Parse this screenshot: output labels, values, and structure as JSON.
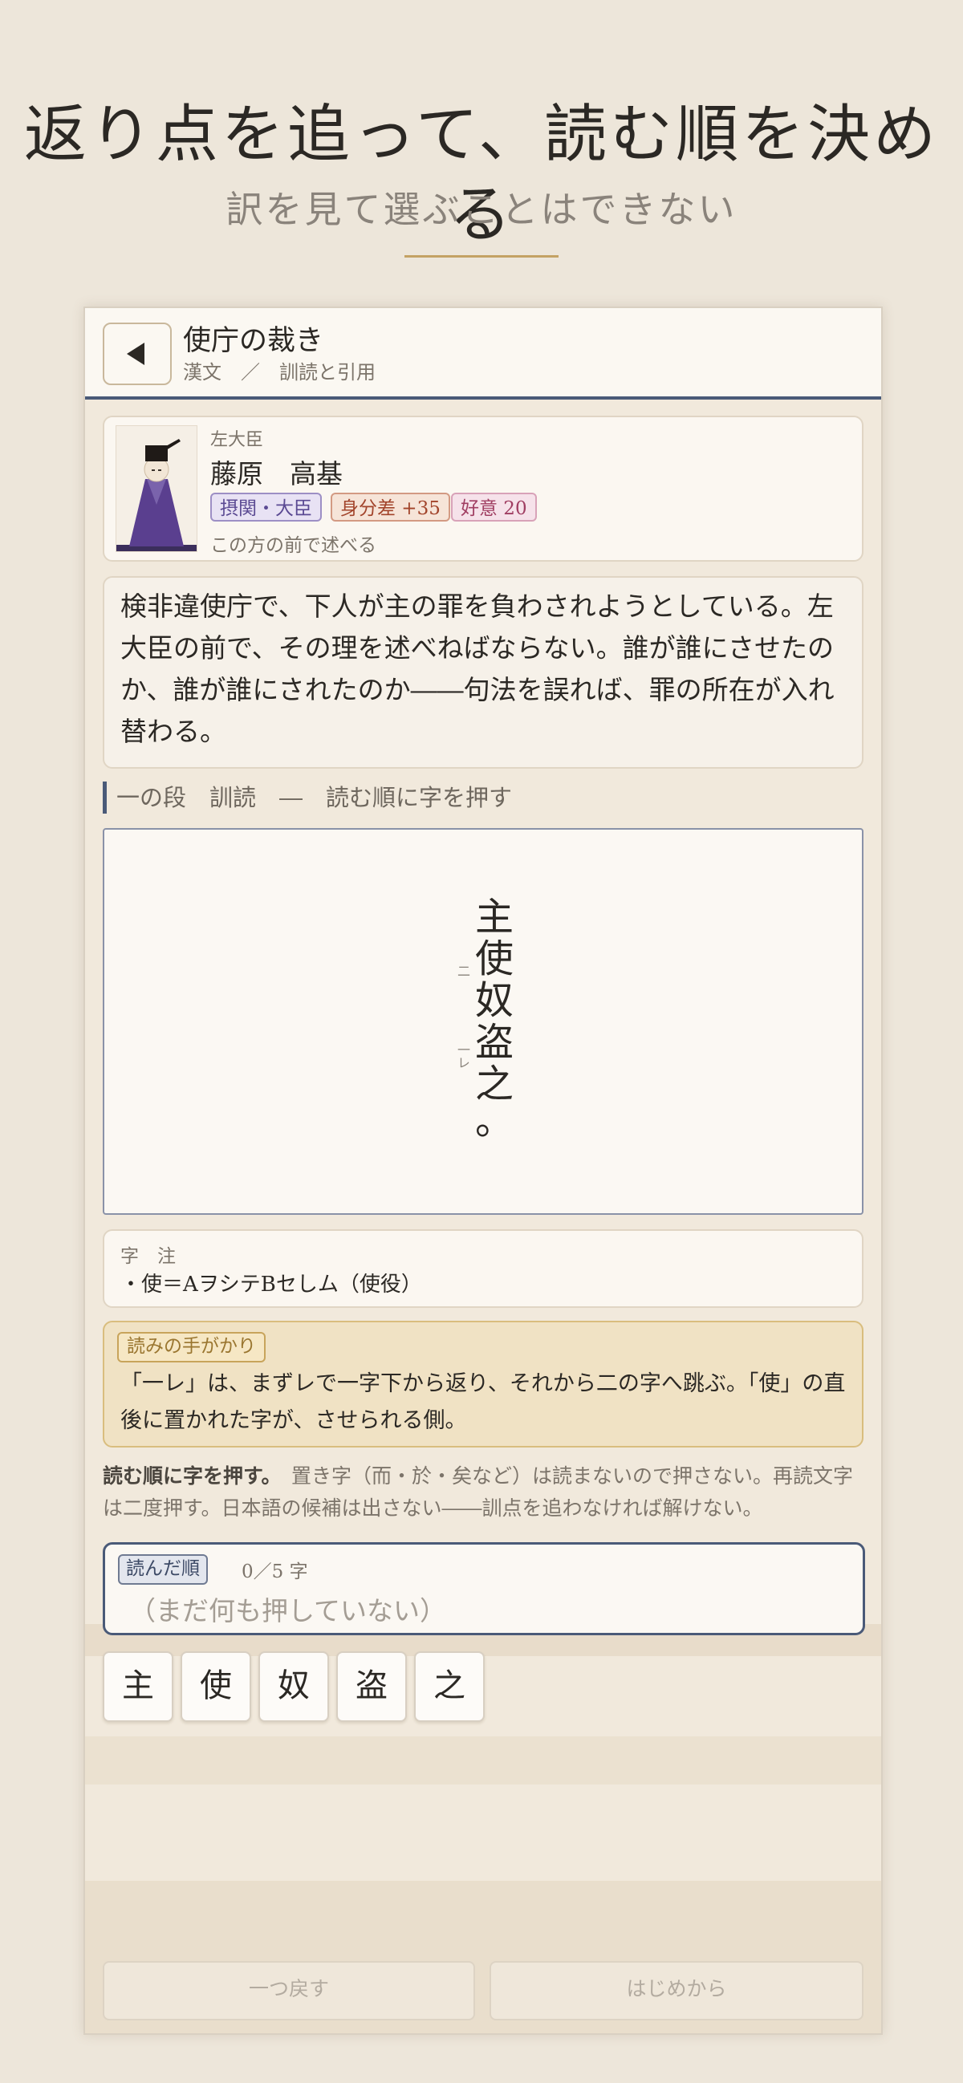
{
  "headline": {
    "title": "返り点を追って、読む順を決める",
    "subtitle": "訳を見て選ぶことはできない"
  },
  "appbar": {
    "back_icon": "back-triangle-icon",
    "title": "使庁の裁き",
    "breadcrumb": "漢文　／　訓読と引用"
  },
  "speaker": {
    "role": "左大臣",
    "name": "藤原　高基",
    "tags": [
      "摂関・大臣",
      "身分差 +35",
      "好意 20"
    ],
    "note": "この方の前で述べる",
    "colors": {
      "robe": "#5a3f8f",
      "hat": "#1f1a17"
    }
  },
  "narrative": "検非違使庁で、下人が主の罪を負わされようとしている。左大臣の前で、その理を述べねばならない。誰が誰にさせたのか、誰が誰にされたのか――句法を誤れば、罪の所在が入れ替わる。",
  "section_label": "一の段　訓読　―　読む順に字を押す",
  "kanbun": {
    "chars": [
      "主",
      "使",
      "奴",
      "盗",
      "之",
      "。"
    ],
    "kunten": [
      "",
      "二",
      "",
      "一レ",
      "",
      ""
    ]
  },
  "notes": {
    "heading": "字　注",
    "items": [
      "・使＝AヲシテBセしム（使役）"
    ]
  },
  "hint": {
    "badge": "読みの手がかり",
    "text": "「一レ」は、まずレで一字下から返り、それから二の字へ跳ぶ。「使」の直後に置かれた字が、させられる側。"
  },
  "instructions": {
    "lead": "読む順に字を押す。",
    "body": "置き字（而・於・矣など）は読まないので押さない。再読文字は二度押す。日本語の候補は出さない――訓点を追わなければ解けない。"
  },
  "order": {
    "badge": "読んだ順",
    "count": "0／5 字",
    "empty": "（まだ何も押していない）"
  },
  "keys": [
    "主",
    "使",
    "奴",
    "盗",
    "之"
  ],
  "bottom": {
    "undo": "一つ戻す",
    "restart": "はじめから"
  }
}
